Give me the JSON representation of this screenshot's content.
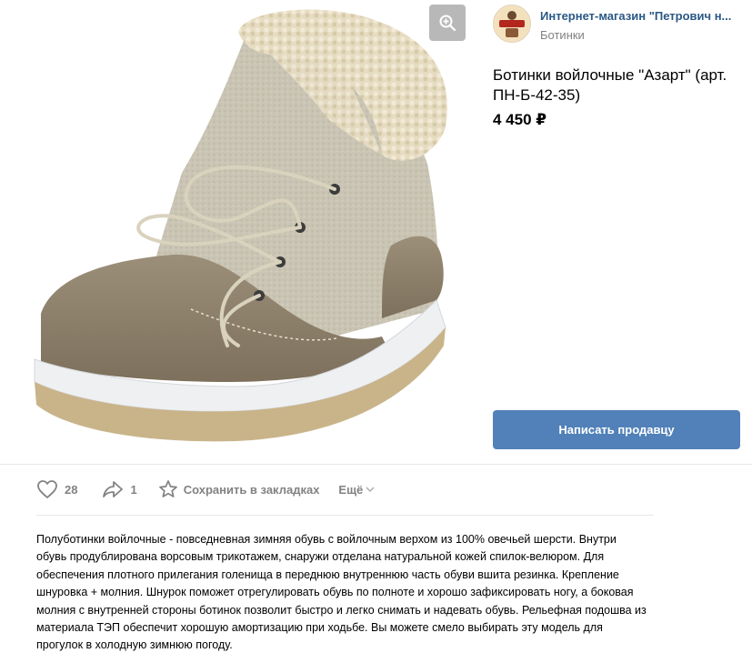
{
  "shop": {
    "name": "Интернет-магазин \"Петрович н...",
    "category": "Ботинки",
    "avatar_text": "ПЕТРОВИЧ"
  },
  "product": {
    "title": "Ботинки войлочные \"Азарт\" (арт. ПН-Б-42-35)",
    "price": "4 450 ₽"
  },
  "buttons": {
    "write_seller": "Написать продавцу",
    "zoom_icon": "zoom-in-icon"
  },
  "actions": {
    "likes_count": "28",
    "shares_count": "1",
    "bookmark_label": "Сохранить в закладках",
    "more_label": "Ещё"
  },
  "description": "Полуботинки войлочные - повседневная зимняя обувь с войлочным верхом из 100% овечьей шерсти. Внутри обувь продублирована ворсовым трикотажем, снаружи отделана натуральной кожей спилок-велюром. Для обеспечения плотного прилегания голенища в переднюю внутреннюю часть обуви вшита резинка. Крепление шнуровка + молния. Шнурок поможет отрегулировать обувь по полноте и хорошо зафиксировать ногу, а боковая молния с внутренней стороны ботинок позволит быстро и легко снимать и надевать обувь. Рельефная подошва из материала ТЭП обеспечит хорошую амортизацию при ходьбе. Вы можете смело выбирать эту модель для прогулок в холодную зимнюю погоду.",
  "colors": {
    "link": "#2a5885",
    "button": "#5181b8",
    "muted": "#828282"
  }
}
